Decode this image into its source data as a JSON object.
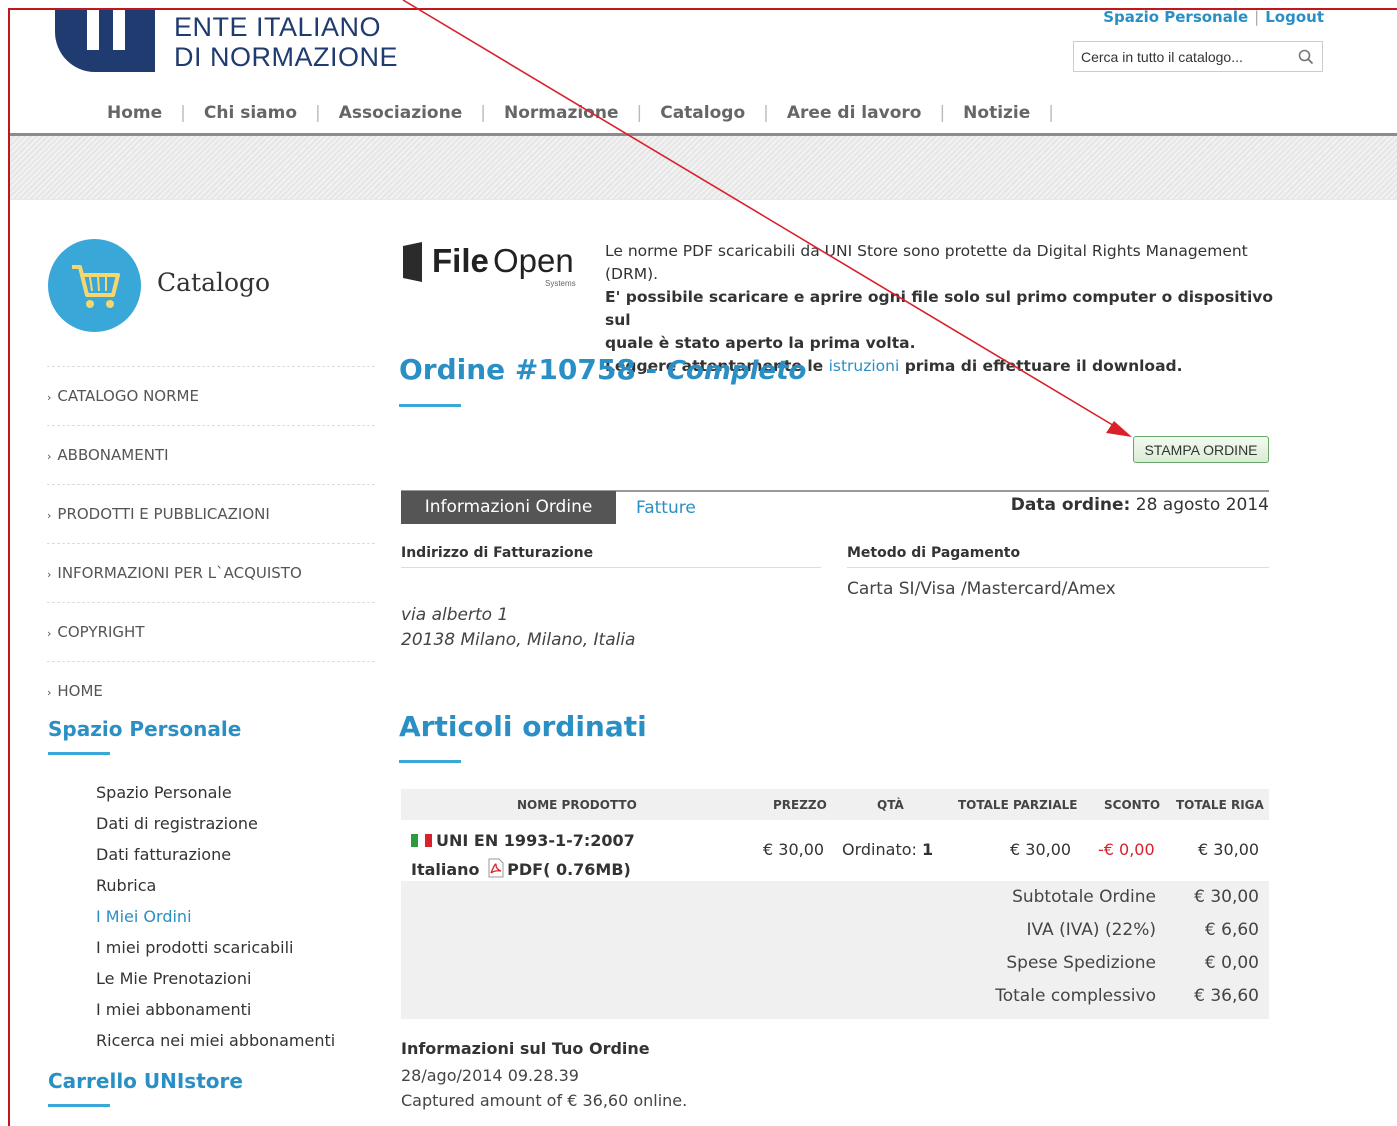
{
  "header": {
    "logo_line1": "ENTE ITALIANO",
    "logo_line2": "DI NORMAZIONE",
    "top_links": [
      "Spazio Personale",
      "Logout"
    ],
    "search_placeholder": "Cerca in tutto il catalogo..."
  },
  "nav": [
    "Home",
    "Chi siamo",
    "Associazione",
    "Normazione",
    "Catalogo",
    "Aree di lavoro",
    "Notizie"
  ],
  "sidebar": {
    "title": "Catalogo",
    "menu": [
      "CATALOGO NORME",
      "ABBONAMENTI",
      "PRODOTTI E PUBBLICAZIONI",
      "INFORMAZIONI PER L`ACQUISTO",
      "COPYRIGHT",
      "HOME"
    ],
    "personal_heading": "Spazio Personale",
    "personal_items": [
      "Spazio Personale",
      "Dati di registrazione",
      "Dati fatturazione",
      "Rubrica",
      "I Miei Ordini",
      "I miei prodotti scaricabili",
      "Le Mie Prenotazioni",
      "I miei abbonamenti",
      "Ricerca nei miei abbonamenti"
    ],
    "cart_heading": "Carrello UNIstore"
  },
  "fileopen": {
    "brand_bold": "File",
    "brand_light": "Open",
    "brand_sub": "Systems",
    "line1": "Le norme PDF scaricabili da UNI Store sono protette da Digital Rights Management (DRM).",
    "line2": "E' possibile scaricare e aprire ogni file solo sul primo computer o dispositivo sul",
    "line3": "quale è stato aperto la prima volta.",
    "line4_pre": "Leggere attentamente le ",
    "line4_link": "istruzioni",
    "line4_post": " prima di effettuare il download."
  },
  "order": {
    "title": "Ordine #10758 - ",
    "status": "Completo",
    "print_label": "STAMPA ORDINE",
    "tab_info": "Informazioni Ordine",
    "tab_invoices": "Fatture",
    "date_label": "Data ordine:",
    "date_value": " 28 agosto 2014",
    "billing_heading": "Indirizzo di Fatturazione",
    "billing_line1": "via alberto 1",
    "billing_line2": "20138 Milano, Milano, Italia",
    "payment_heading": "Metodo di Pagamento",
    "payment_value": "Carta SI/Visa /Mastercard/Amex"
  },
  "articles": {
    "title": "Articoli ordinati",
    "columns": [
      "NOME PRODOTTO",
      "PREZZO",
      "QTÀ",
      "TOTALE PARZIALE",
      "SCONTO",
      "TOTALE RIGA"
    ],
    "row": {
      "name": "UNI EN 1993-1-7:2007",
      "lang": "Italiano",
      "format": "PDF( 0.76MB)",
      "price": "€ 30,00",
      "qty_label": "Ordinato: ",
      "qty": "1",
      "subtotal": "€ 30,00",
      "discount": "-€ 0,00",
      "total": "€ 30,00"
    },
    "totals": [
      {
        "label": "Subtotale Ordine",
        "value": "€ 30,00"
      },
      {
        "label": "IVA (IVA) (22%)",
        "value": "€ 6,60"
      },
      {
        "label": "Spese Spedizione",
        "value": "€ 0,00"
      },
      {
        "label": "Totale complessivo",
        "value": "€ 36,60"
      }
    ]
  },
  "order_info": {
    "heading": "Informazioni sul Tuo Ordine",
    "timestamp": "28/ago/2014 09.28.39",
    "captured": "Captured amount of € 36,60 online."
  },
  "icons": {
    "search": "search-icon",
    "cart": "cart-icon",
    "pdf": "pdf-icon",
    "flag": "italian-flag-icon"
  },
  "colors": {
    "accent": "#2a8fc4",
    "brand": "#1f3b6f",
    "annotation": "#d9212b"
  }
}
